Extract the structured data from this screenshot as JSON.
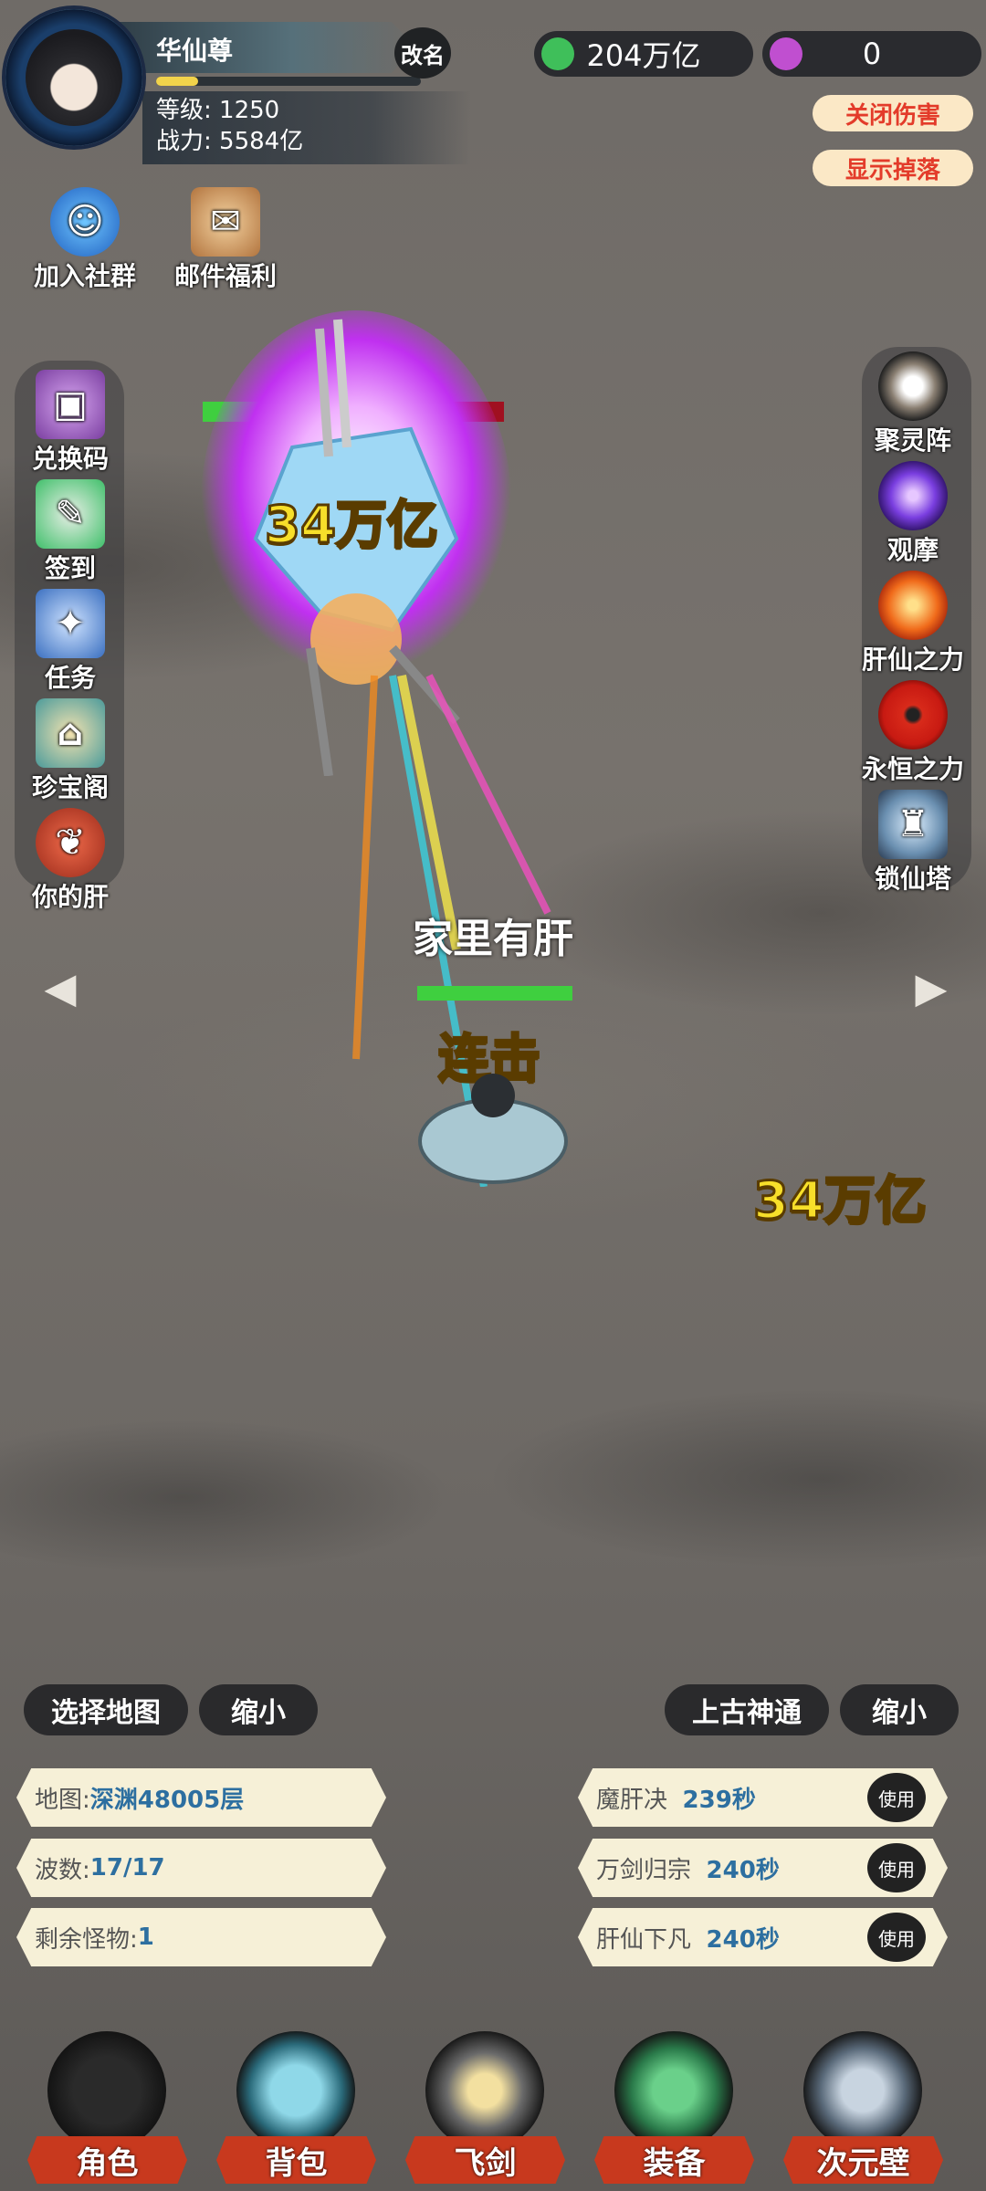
{
  "player": {
    "name": "华仙尊",
    "rename": "改名",
    "level_label": "等级:",
    "level": "1250",
    "power_label": "战力:",
    "power": "5584亿",
    "exp_fraction": 0.16
  },
  "currency": {
    "gems": "204万亿",
    "orbs": "0",
    "gem_color": "#3fbf5a",
    "orb_color": "#c04fd0"
  },
  "toggles": {
    "close_damage": "关闭伤害",
    "show_drops": "显示掉落"
  },
  "top_icons": [
    {
      "label": "加入社群",
      "icon": "community-icon"
    },
    {
      "label": "邮件福利",
      "icon": "mail-chest-icon"
    }
  ],
  "left_icons": [
    {
      "label": "兑换码",
      "icon": "chest-icon"
    },
    {
      "label": "签到",
      "icon": "scroll-icon"
    },
    {
      "label": "任务",
      "icon": "quest-icon"
    },
    {
      "label": "珍宝阁",
      "icon": "pavilion-icon"
    },
    {
      "label": "你的肝",
      "icon": "liver-icon"
    }
  ],
  "right_icons": [
    {
      "label": "聚灵阵",
      "icon": "array-icon"
    },
    {
      "label": "观摩",
      "icon": "orb-icon"
    },
    {
      "label": "肝仙之力",
      "icon": "fire-orb-icon"
    },
    {
      "label": "永恒之力",
      "icon": "sharingan-icon"
    },
    {
      "label": "锁仙塔",
      "icon": "tower-icon"
    }
  ],
  "battle": {
    "enemy_damage": "34万亿",
    "floating_damage": "34万亿",
    "combo_text": "连击",
    "player_title": "家里有肝",
    "enemy_hp_fraction": 0.22,
    "player_hp_fraction": 1.0
  },
  "controls": {
    "select_map": "选择地图",
    "shrink_left": "缩小",
    "ancient_power": "上古神通",
    "shrink_right": "缩小"
  },
  "map_info": [
    {
      "label": "地图:",
      "value": "深渊48005层"
    },
    {
      "label": "波数:",
      "value": "17/17"
    },
    {
      "label": "剩余怪物:",
      "value": "1"
    }
  ],
  "skills": [
    {
      "name": "魔肝决",
      "cooldown": "239秒",
      "use": "使用"
    },
    {
      "name": "万剑归宗",
      "cooldown": "240秒",
      "use": "使用"
    },
    {
      "name": "肝仙下凡",
      "cooldown": "240秒",
      "use": "使用"
    }
  ],
  "nav": [
    {
      "label": "角色"
    },
    {
      "label": "背包"
    },
    {
      "label": "飞剑"
    },
    {
      "label": "装备"
    },
    {
      "label": "次元壁"
    }
  ]
}
